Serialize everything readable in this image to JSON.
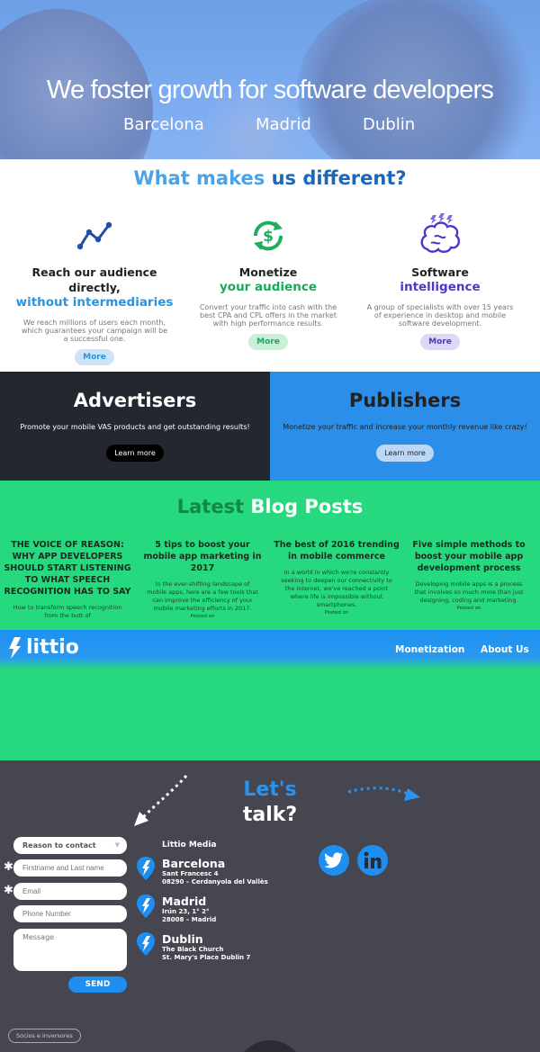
{
  "hero": {
    "title": "We foster growth for software developers",
    "cities": [
      "Barcelona",
      "Madrid",
      "Dublin"
    ]
  },
  "different": {
    "title_a": "What makes",
    "title_b": "us different?",
    "features": [
      {
        "title": "Reach our audience directly,",
        "highlight": "without intermediaries",
        "text": "We reach millions of users each month, which guarantees your campaign will be a successful one.",
        "button": "More",
        "color": "#2a93e0",
        "btn_bg": "#cfe3f6",
        "icon": "line-chart-icon"
      },
      {
        "title": "Monetize",
        "highlight": "your audience",
        "text": "Convert your traffic into cash with the best CPA and CPL offers in the market with high performance results.",
        "button": "More",
        "color": "#1aa85b",
        "btn_bg": "#c9efd8",
        "icon": "money-refresh-icon"
      },
      {
        "title": "Software",
        "highlight": "intelligence",
        "text": "A group of specialists with over 15 years of experience in desktop and mobile software development.",
        "button": "More",
        "color": "#4a39c9",
        "btn_bg": "#ddd8f4",
        "icon": "brain-icon"
      }
    ]
  },
  "advertisers": {
    "title": "Advertisers",
    "text": "Promote your mobile VAS products and get outstanding results!",
    "button": "Learn more"
  },
  "publishers": {
    "title": "Publishers",
    "text": "Monetize your traffic and increase your monthly revenue like crazy!",
    "button": "Learn more"
  },
  "blog": {
    "title_a": "Latest",
    "title_b": "Blog Posts",
    "posts": [
      {
        "title": "THE VOICE OF REASON: WHY APP DEVELOPERS SHOULD START LISTENING TO WHAT SPEECH RECOGNITION HAS TO SAY",
        "excerpt": "How to transform speech recognition from the butt of",
        "posted": ""
      },
      {
        "title": "5 tips to boost your mobile app marketing in 2017",
        "excerpt": "In the ever-shifting landscape of mobile apps, here are a few tools that can improve the efficiency of your mobile marketing efforts in 2017.",
        "posted": "Posted on"
      },
      {
        "title": "The best of 2016 trending in mobile commerce",
        "excerpt": "In a world in which we're constantly seeking to deepen our connectivity to the internet, we've reached a point where life is impossible without smartphones.",
        "posted": "Posted on"
      },
      {
        "title": "Five simple methods to boost your mobile app development process",
        "excerpt": "Developing mobile apps is a process that involves so much more than just designing, coding and marketing.",
        "posted": "Posted on"
      }
    ]
  },
  "nav": {
    "logo": "littio",
    "links": [
      "Monetization",
      "About Us"
    ]
  },
  "contact": {
    "lets": "Let's",
    "talk": "talk?",
    "reason_label": "Reason to contact",
    "name_placeholder": "Firstname and Last name",
    "email_placeholder": "Email",
    "phone_placeholder": "Phone Number",
    "message_placeholder": "Message",
    "send": "SEND",
    "company": "Littio Media",
    "offices": [
      {
        "city": "Barcelona",
        "line1": "Sant Francesc 4",
        "line2": "08290 – Cerdanyola del Vallès"
      },
      {
        "city": "Madrid",
        "line1": "Irún 23, 1° 2°",
        "line2": "28008 – Madrid"
      },
      {
        "city": "Dublin",
        "line1": "The Black Church",
        "line2": "St. Mary's Place Dublin 7"
      }
    ],
    "socios": "Socios e inversores"
  },
  "colors": {
    "accent_blue": "#1e8ef0",
    "green": "#27d97e",
    "dark": "#252730"
  }
}
